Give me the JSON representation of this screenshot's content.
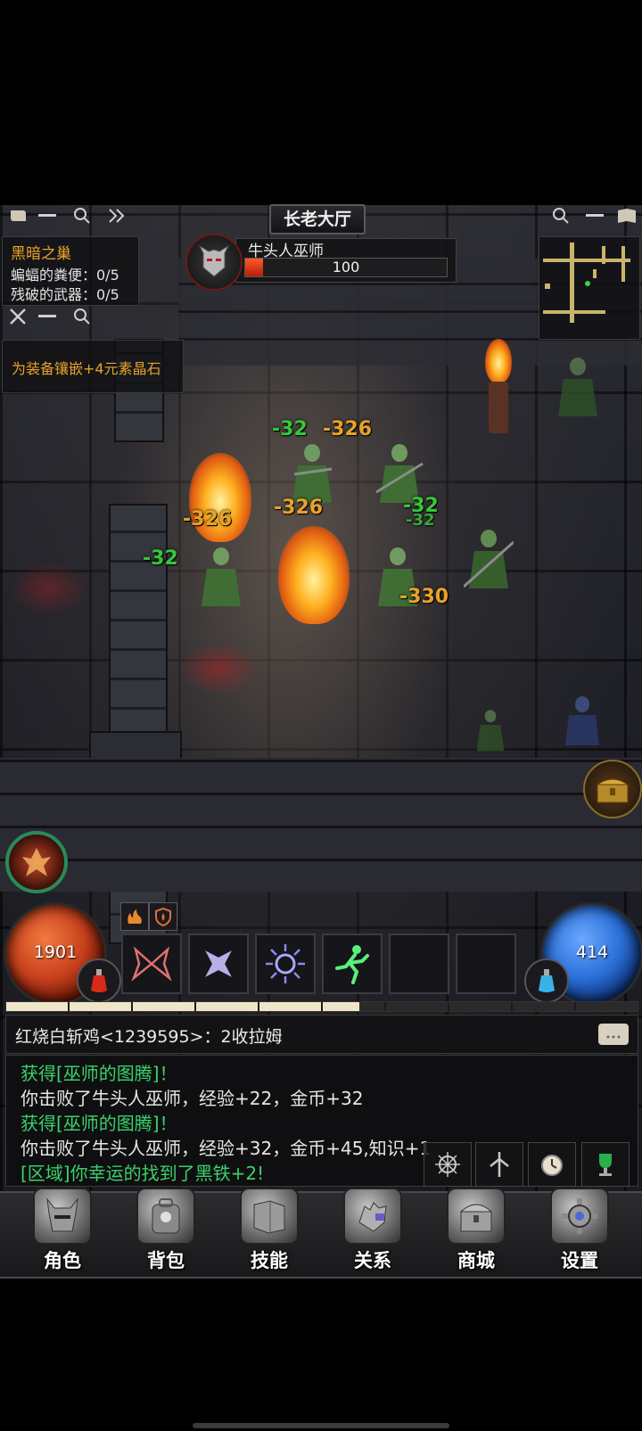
{
  "room_title": "长老大厅",
  "quest": {
    "title": "黑暗之巢",
    "items": [
      "蝙蝠的粪便：0/5",
      "残破的武器：0/5"
    ]
  },
  "tip": "为装备镶嵌+4元素晶石",
  "target": {
    "name": "牛头人巫师",
    "hp_text": "100",
    "hp_fraction": 0.09
  },
  "damage": [
    {
      "text": "-32",
      "color": "g"
    },
    {
      "text": "-326",
      "color": "o"
    },
    {
      "text": "-326",
      "color": "o"
    },
    {
      "text": "-326",
      "color": "o"
    },
    {
      "text": "-32",
      "color": "g"
    },
    {
      "text": "-32",
      "color": "g"
    },
    {
      "text": "-32",
      "color": "g"
    },
    {
      "text": "-330",
      "color": "o"
    }
  ],
  "player": {
    "hp_value": "1901",
    "mp_value": "414"
  },
  "chat": {
    "latest": "红烧白斩鸡<1239595>：2收拉姆"
  },
  "log": [
    {
      "text": "获得[巫师的图腾]！",
      "color": "#38d26a"
    },
    {
      "text": "你击败了牛头人巫师，经验+22，金币+32",
      "color": "#e6e6e6"
    },
    {
      "text": "获得[巫师的图腾]！",
      "color": "#38d26a"
    },
    {
      "text": "你击败了牛头人巫师，经验+32，金币+45,知识+1",
      "color": "#e6e6e6"
    },
    {
      "text": "[区域]你幸运的找到了黑铁+2!",
      "color": "#38d26a"
    }
  ],
  "tabs": [
    {
      "label": "角色",
      "icon": "helmet-icon"
    },
    {
      "label": "背包",
      "icon": "backpack-icon"
    },
    {
      "label": "技能",
      "icon": "skillbook-icon"
    },
    {
      "label": "关系",
      "icon": "gauntlet-icon"
    },
    {
      "label": "商城",
      "icon": "chest-icon"
    },
    {
      "label": "设置",
      "icon": "gear-icon"
    }
  ],
  "xp_segments": [
    1,
    1,
    1,
    1,
    1,
    0.6,
    0,
    0,
    0,
    0
  ],
  "colors": {
    "hp_orb": "#c8401c",
    "mp_orb": "#2a6fd8",
    "hp_bar": "#d83a1a",
    "accent": "#e8a22a"
  }
}
